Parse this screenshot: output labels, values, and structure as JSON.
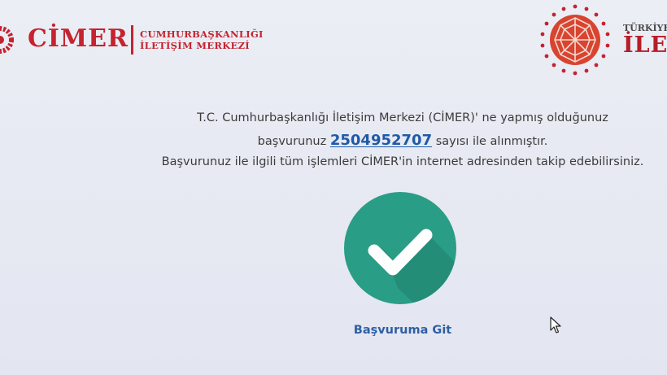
{
  "header": {
    "cimer_wordmark": "CİMER",
    "cimer_sub_line1": "CUMHURBAŞKANLIĞI",
    "cimer_sub_line2": "İLETİŞİM MERKEZİ",
    "right_brand_small": "TÜRKİYE",
    "right_brand_big": "İLET"
  },
  "message": {
    "line1": "T.C. Cumhurbaşkanlığı İletişim Merkezi (CİMER)' ne yapmış olduğunuz",
    "line2_prefix": "başvurunuz",
    "application_number": "2504952707",
    "line2_suffix": "sayısı ile alınmıştır.",
    "line3": "Başvurunuz ile ilgili tüm işlemleri CİMER'in internet adresinden takip edebilirsiniz."
  },
  "actions": {
    "go_to_application": "Başvuruma Git"
  },
  "icons": {
    "success": "check-circle-icon",
    "cursor": "mouse-pointer-icon"
  },
  "colors": {
    "brand_red": "#c4232f",
    "success_teal": "#2a9d86",
    "link_blue": "#2e5fa3"
  }
}
